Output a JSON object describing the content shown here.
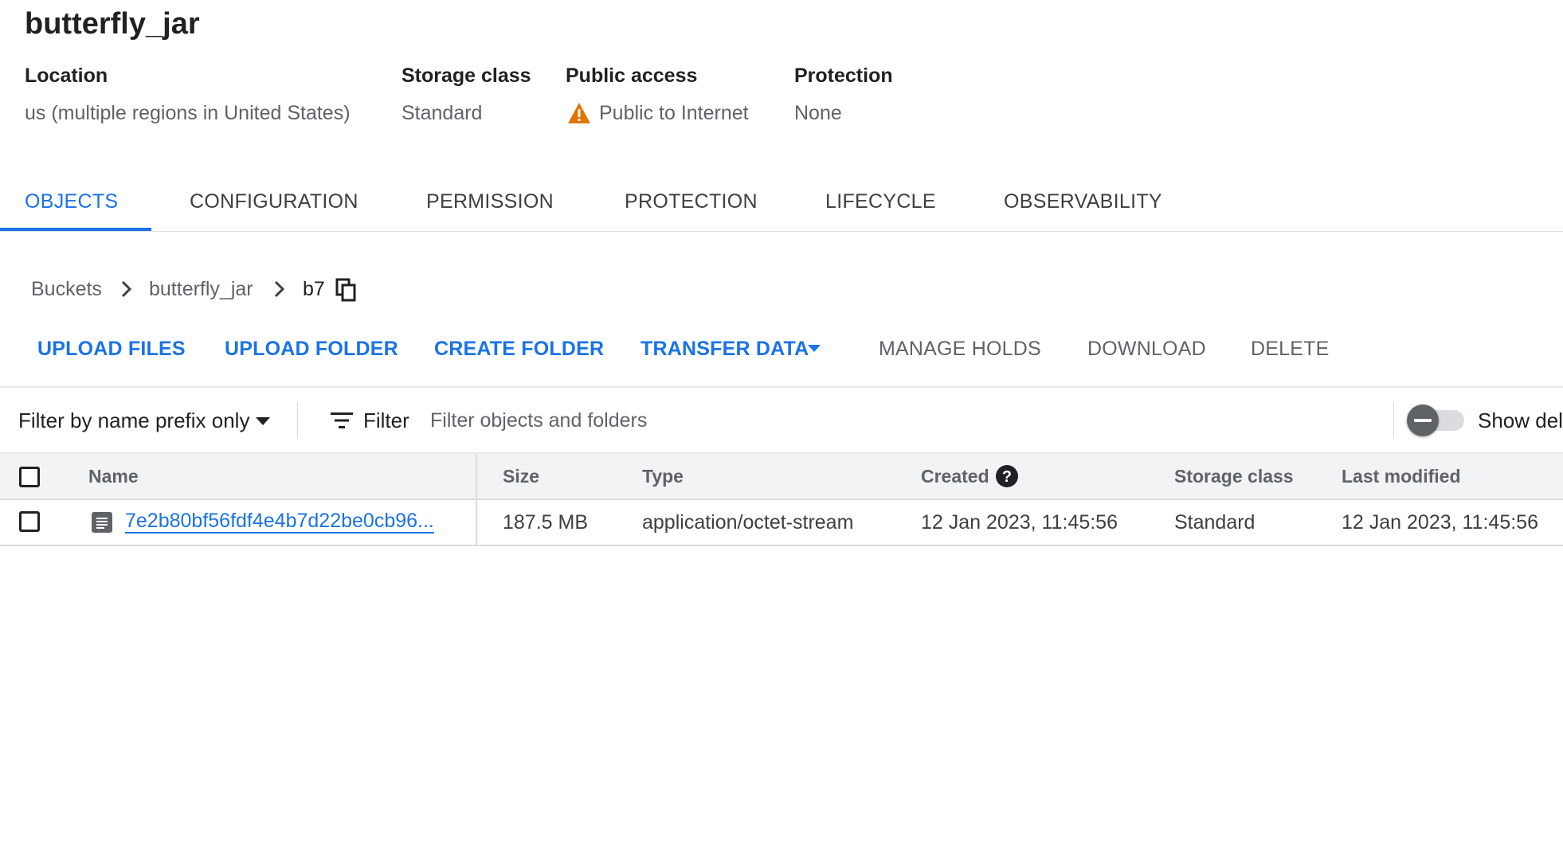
{
  "bucket": {
    "name": "butterfly_jar",
    "details": [
      {
        "label": "Location",
        "value": "us (multiple regions in United States)"
      },
      {
        "label": "Storage class",
        "value": "Standard"
      },
      {
        "label": "Public access",
        "value": "Public to Internet",
        "icon": "warning-icon",
        "icon_color": "#e37400"
      },
      {
        "label": "Protection",
        "value": "None"
      }
    ]
  },
  "tabs": [
    {
      "label": "OBJECTS",
      "active": true
    },
    {
      "label": "CONFIGURATION",
      "active": false
    },
    {
      "label": "PERMISSION",
      "active": false
    },
    {
      "label": "PROTECTION",
      "active": false
    },
    {
      "label": "LIFECYCLE",
      "active": false
    },
    {
      "label": "OBSERVABILITY",
      "active": false
    }
  ],
  "breadcrumb": {
    "items": [
      "Buckets",
      "butterfly_jar",
      "b7"
    ],
    "copy_icon": "copy-icon"
  },
  "actions": {
    "upload_files": "UPLOAD FILES",
    "upload_folder": "UPLOAD FOLDER",
    "create_folder": "CREATE FOLDER",
    "transfer_data": "TRANSFER DATA",
    "manage_holds": "MANAGE HOLDS",
    "download": "DOWNLOAD",
    "delete": "DELETE"
  },
  "filter": {
    "mode": "Filter by name prefix only",
    "label": "Filter",
    "placeholder": "Filter objects and folders",
    "toggle_label": "Show del",
    "toggle_on": false
  },
  "table": {
    "columns": [
      "Name",
      "Size",
      "Type",
      "Created",
      "Storage class",
      "Last modified"
    ],
    "rows": [
      {
        "name": "7e2b80bf56fdf4e4b7d22be0cb96...",
        "size": "187.5 MB",
        "type": "application/octet-stream",
        "created": "12 Jan 2023, 11:45:56",
        "storage_class": "Standard",
        "last_modified": "12 Jan 2023, 11:45:56"
      }
    ]
  },
  "colors": {
    "accent": "#1a73e8",
    "warning": "#e37400",
    "muted_text": "#5f6368",
    "header_bg": "#f1f3f4"
  }
}
